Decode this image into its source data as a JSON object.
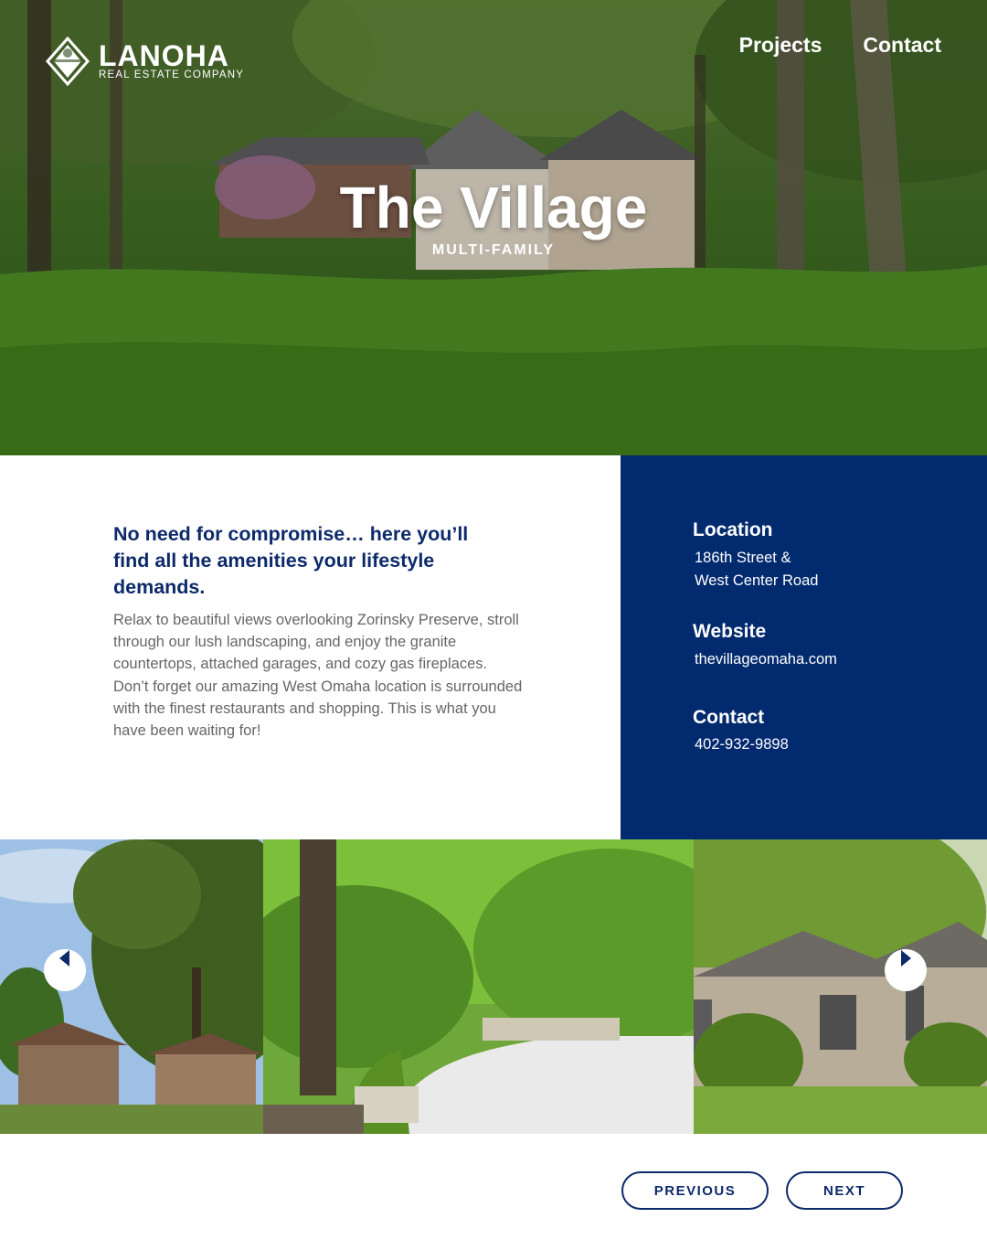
{
  "brand": {
    "name": "LANOHA",
    "tagline": "REAL ESTATE COMPANY"
  },
  "nav": {
    "items": [
      {
        "label": "Projects"
      },
      {
        "label": "Contact"
      }
    ]
  },
  "hero": {
    "title": "The Village",
    "subtitle": "MULTI-FAMILY"
  },
  "intro": {
    "headline": "No need for compromise… here you’ll find all the amenities your lifestyle demands.",
    "body": "Relax to beautiful views overlooking Zorinsky Preserve, stroll through our lush landscaping, and enjoy the granite countertops, attached garages, and cozy gas fireplaces. Don’t forget our amazing West Omaha location is surrounded with the finest restaurants and shopping. This is what you have been waiting for!"
  },
  "details": {
    "location_label": "Location",
    "location_line1": "186th Street &",
    "location_line2": "West Center Road",
    "website_label": "Website",
    "website_value": "thevillageomaha.com",
    "contact_label": "Contact",
    "contact_value": "402-932-9898"
  },
  "pager": {
    "previous_label": "PREVIOUS",
    "next_label": "NEXT"
  },
  "colors": {
    "navy": "#022a6e",
    "heading": "#0d2a6b",
    "body_text": "#666666"
  }
}
